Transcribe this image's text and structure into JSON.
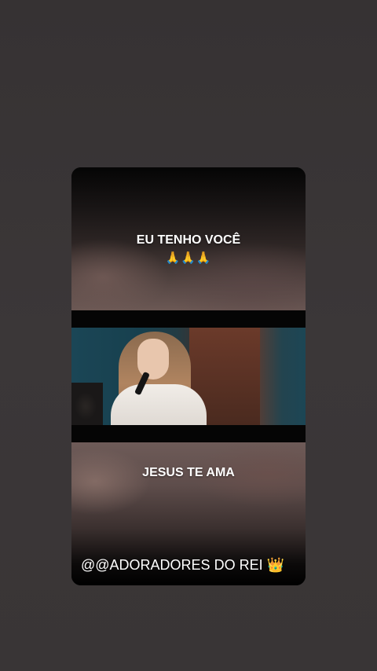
{
  "story": {
    "caption_top": "EU TENHO VOCÊ",
    "emoji_top": "🙏🙏🙏",
    "caption_middle": "JESUS TE AMA",
    "watermark": "@@ADORADORES DO REI",
    "watermark_emoji": "👑"
  },
  "icons": {
    "praying_hands": "praying-hands-icon",
    "crown": "crown-icon"
  }
}
